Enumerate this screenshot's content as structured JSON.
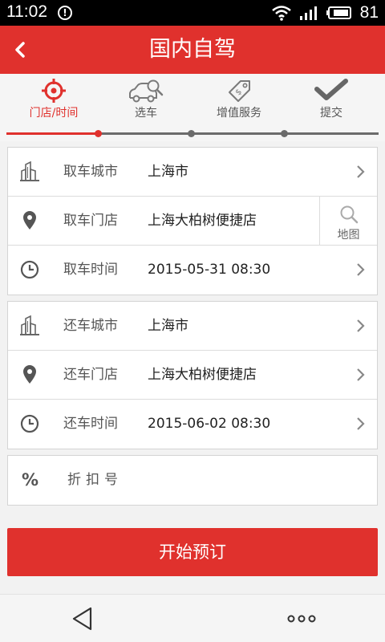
{
  "status_bar": {
    "time": "11:02",
    "battery": "81"
  },
  "header": {
    "title": "国内自驾"
  },
  "steps": [
    {
      "label": "门店/时间",
      "icon": "target-icon",
      "active": true
    },
    {
      "label": "选车",
      "icon": "car-search-icon",
      "active": false
    },
    {
      "label": "增值服务",
      "icon": "price-tag-icon",
      "active": false
    },
    {
      "label": "提交",
      "icon": "checkmark-icon",
      "active": false
    }
  ],
  "progress": {
    "current_step": 1,
    "total_steps": 4
  },
  "pickup": {
    "city_label": "取车城市",
    "city_value": "上海市",
    "store_label": "取车门店",
    "store_value": "上海大柏树便捷店",
    "map_label": "地图",
    "time_label": "取车时间",
    "time_value": "2015-05-31 08:30"
  },
  "return": {
    "city_label": "还车城市",
    "city_value": "上海市",
    "store_label": "还车门店",
    "store_value": "上海大柏树便捷店",
    "time_label": "还车时间",
    "time_value": "2015-06-02 08:30"
  },
  "discount": {
    "icon_text": "%",
    "label": "折扣号"
  },
  "book_button": {
    "label": "开始预订"
  },
  "colors": {
    "accent": "#e0312d",
    "track": "#6b6b6b"
  }
}
